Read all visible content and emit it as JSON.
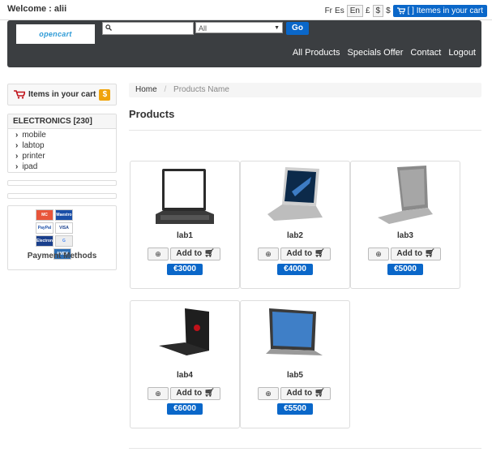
{
  "topbar": {
    "welcome": "Welcome : alii",
    "lang_fr": "Fr",
    "lang_es": "Es",
    "lang_en": "En",
    "currency_gbp": "£",
    "currency_usd_boxed": "$",
    "currency_usd": "$",
    "cart_label": "[ ] Itemes in your cart"
  },
  "header": {
    "logo_text": "opencart",
    "search": {
      "value": "",
      "placeholder": ""
    },
    "category_select": "All",
    "go_label": "Go",
    "nav": [
      "All Products",
      "Specials Offer",
      "Contact",
      "Logout"
    ]
  },
  "sidebar": {
    "cart_label": "Items in your cart",
    "cart_badge": "$",
    "category_header": "ELECTRONICS [230]",
    "categories": [
      "mobile",
      "labtop",
      "printer",
      "ipad"
    ],
    "payment_label": "Payment Methods",
    "cards": [
      "MC",
      "Maestro",
      "PayPal",
      "VISA",
      "Electron",
      "G",
      "AMEX"
    ]
  },
  "breadcrumb": {
    "home": "Home",
    "separator": "/",
    "current": "Products Name"
  },
  "page_title": "Products",
  "products": [
    {
      "name": "lab1",
      "price": "€3000",
      "add_label": "Add to"
    },
    {
      "name": "lab2",
      "price": "€4000",
      "add_label": "Add to"
    },
    {
      "name": "lab3",
      "price": "€5000",
      "add_label": "Add to"
    },
    {
      "name": "lab4",
      "price": "€6000",
      "add_label": "Add to"
    },
    {
      "name": "lab5",
      "price": "€5500",
      "add_label": "Add to"
    }
  ],
  "colors": {
    "primary": "#0a67c9",
    "header_bg": "#3b3e41",
    "badge_orange": "#f0a30a"
  },
  "icons": {
    "cart": "shopping-cart-icon",
    "search": "search-icon",
    "zoom": "zoom-icon",
    "chevron": "chevron-right-icon",
    "dollar": "dollar-icon"
  }
}
